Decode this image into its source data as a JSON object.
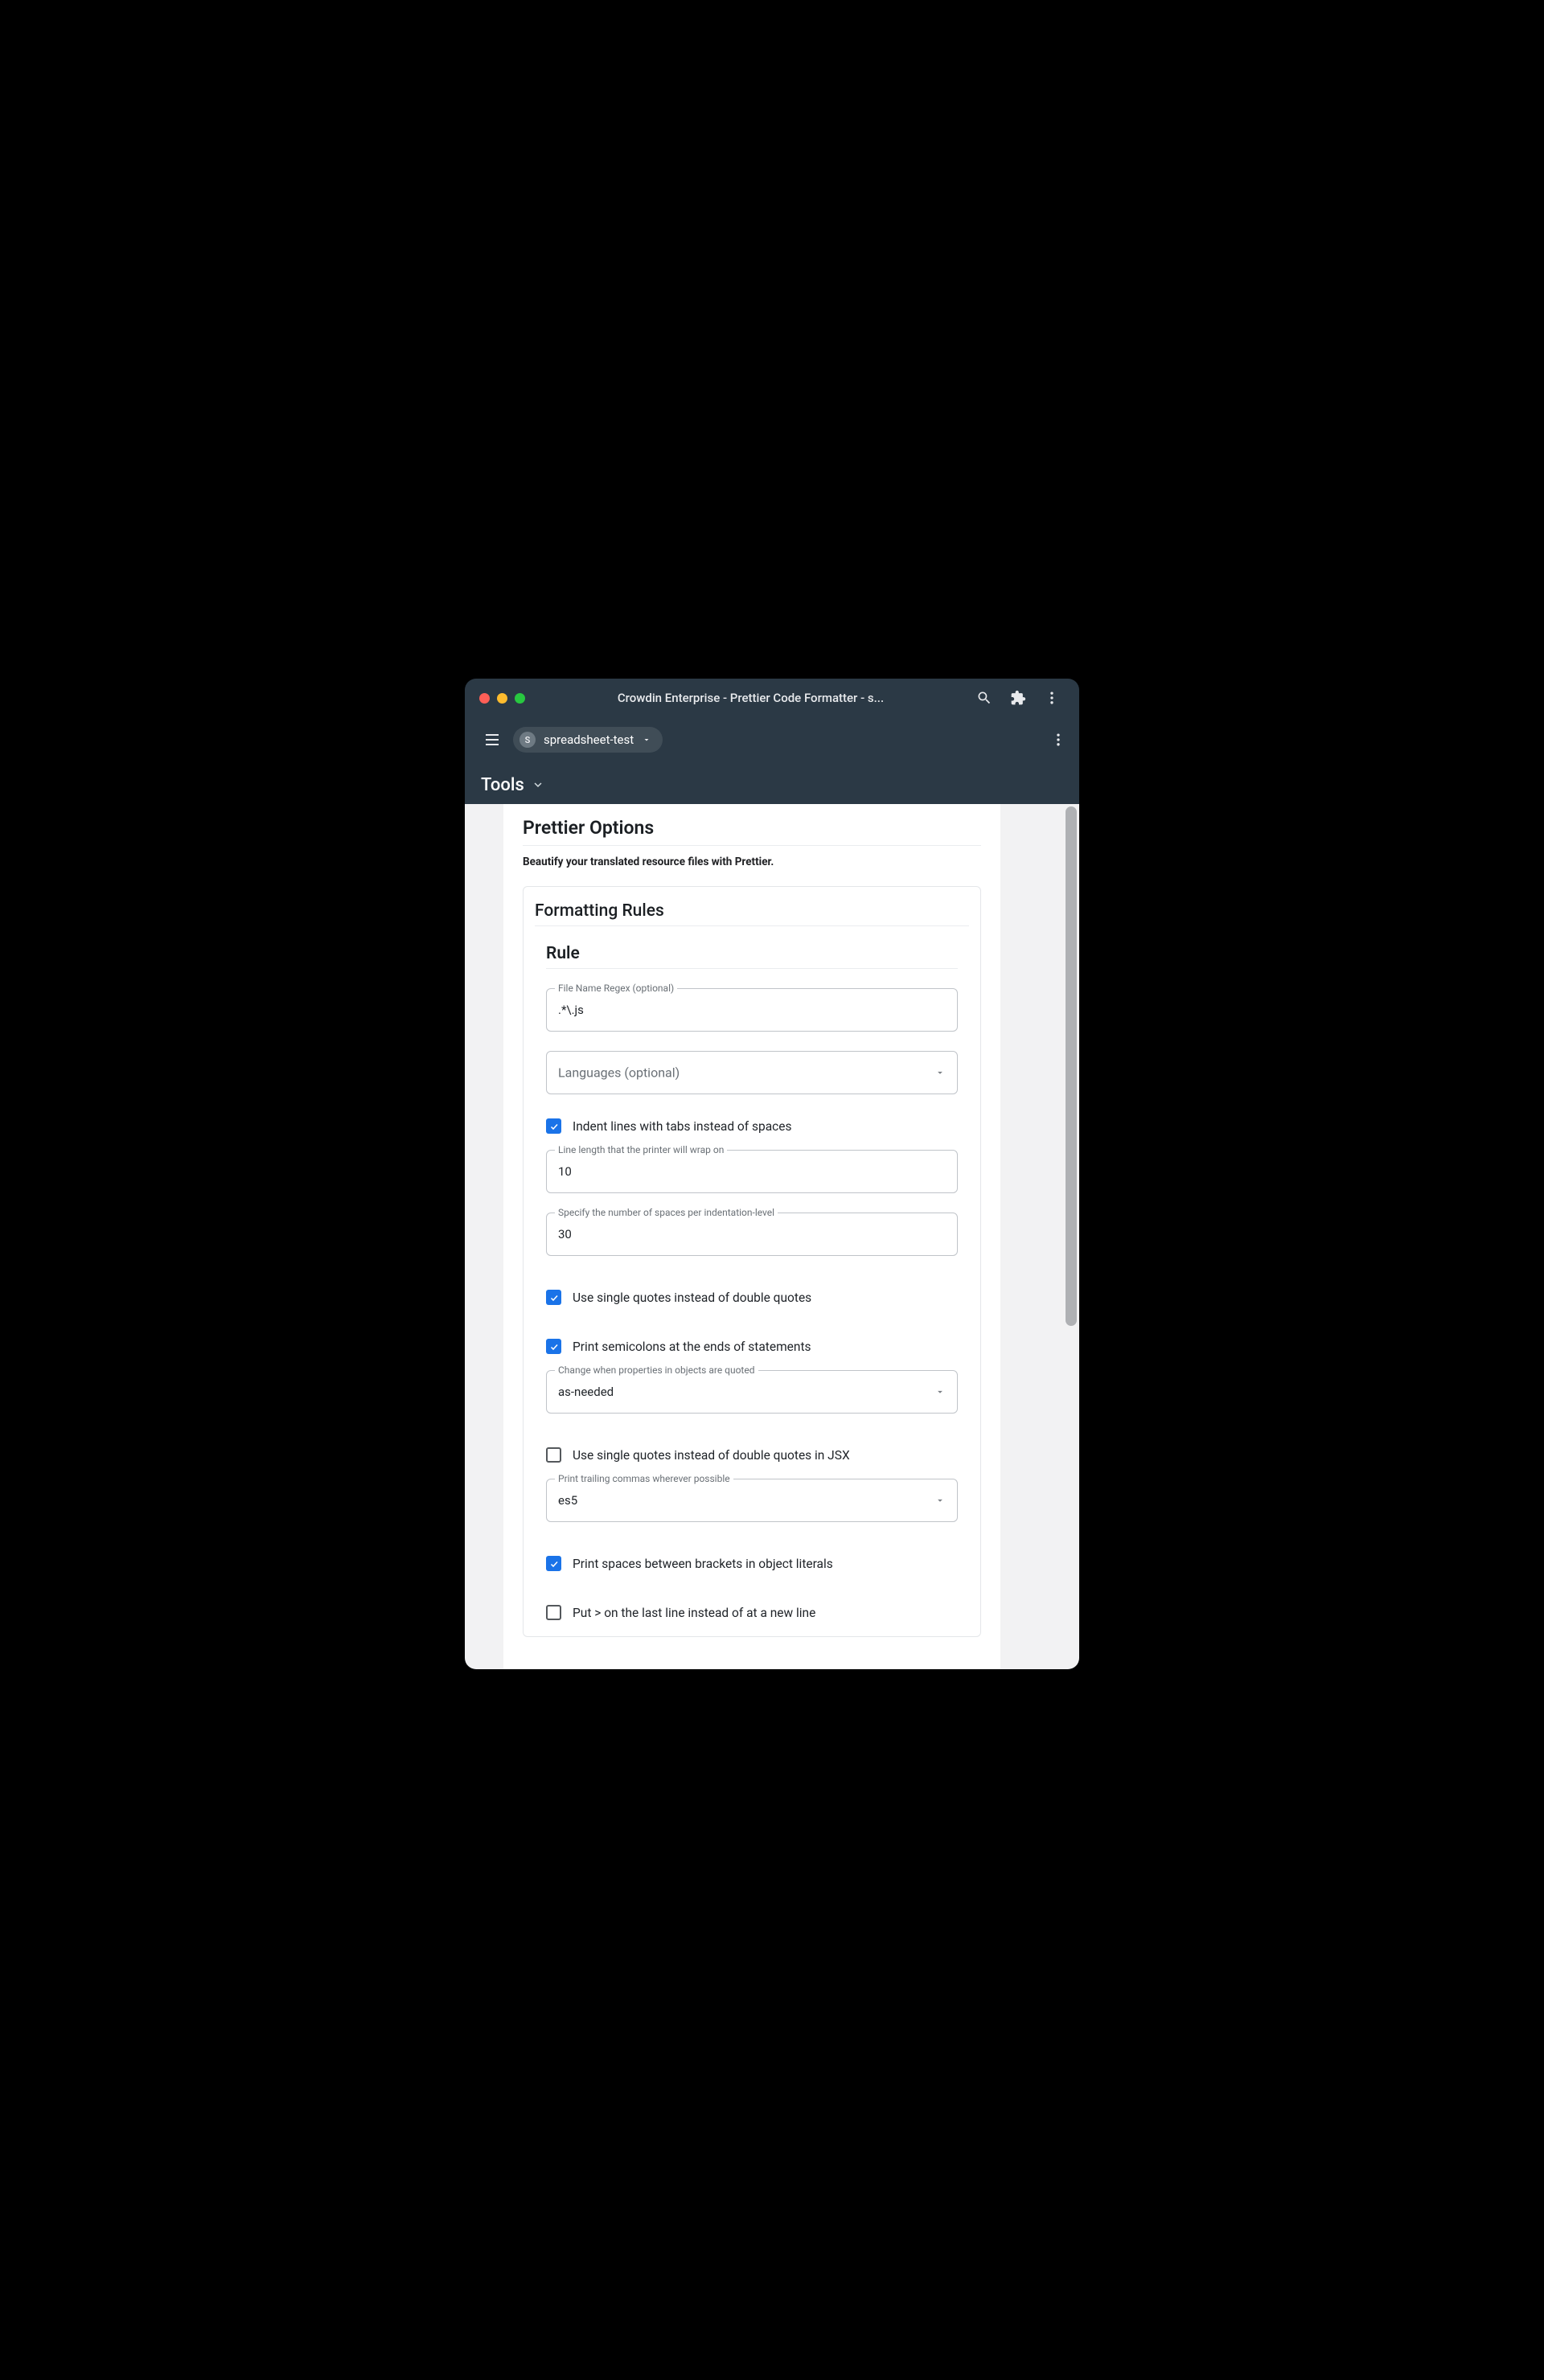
{
  "titlebar": {
    "title": "Crowdin Enterprise - Prettier Code Formatter - s..."
  },
  "toolbar": {
    "project_initial": "S",
    "project_name": "spreadsheet-test"
  },
  "tabs": {
    "active": "Tools"
  },
  "page": {
    "title": "Prettier Options",
    "subtitle": "Beautify your translated resource files with Prettier."
  },
  "card": {
    "title": "Formatting Rules",
    "rule_heading": "Rule"
  },
  "fields": {
    "regex": {
      "label": "File Name Regex (optional)",
      "value": ".*\\.js"
    },
    "languages": {
      "placeholder": "Languages (optional)"
    },
    "line_length": {
      "label": "Line length that the printer will wrap on",
      "value": "10"
    },
    "tab_width": {
      "label": "Specify the number of spaces per indentation-level",
      "value": "30"
    },
    "quote_props": {
      "label": "Change when properties in objects are quoted",
      "value": "as-needed"
    },
    "trailing_comma": {
      "label": "Print trailing commas wherever possible",
      "value": "es5"
    }
  },
  "checks": {
    "use_tabs": {
      "label": "Indent lines with tabs instead of spaces",
      "checked": true
    },
    "single_quote": {
      "label": "Use single quotes instead of double quotes",
      "checked": true
    },
    "semicolons": {
      "label": "Print semicolons at the ends of statements",
      "checked": true
    },
    "jsx_single_quote": {
      "label": "Use single quotes instead of double quotes in JSX",
      "checked": false
    },
    "bracket_spacing": {
      "label": "Print spaces between brackets in object literals",
      "checked": true
    },
    "bracket_same_line": {
      "label": "Put > on the last line instead of at a new line",
      "checked": false
    }
  }
}
